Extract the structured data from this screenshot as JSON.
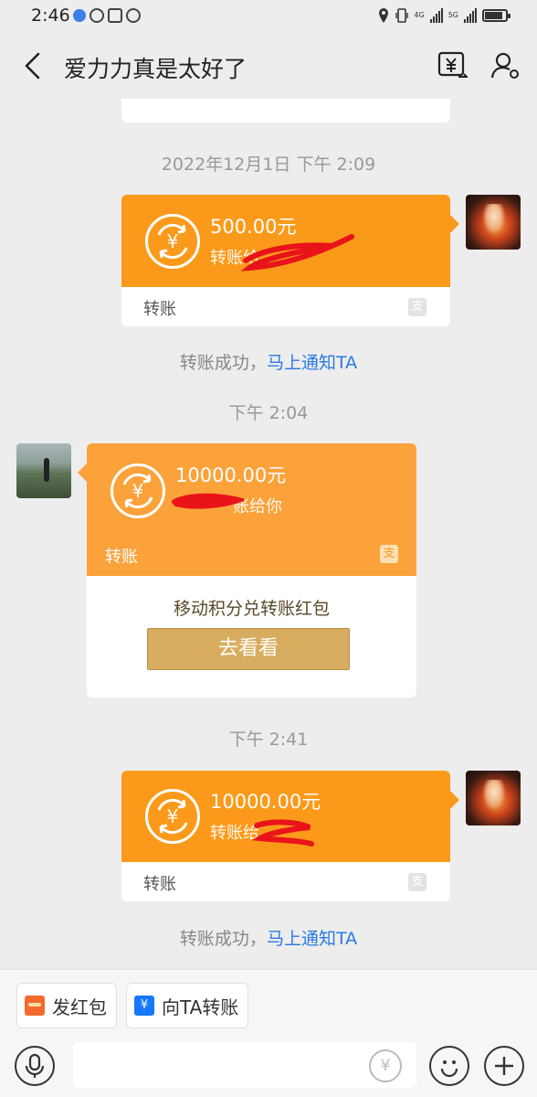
{
  "status_bar": {
    "time": "2:46",
    "network_1": "4G",
    "network_2": "5G",
    "battery_level": 0.85
  },
  "header": {
    "title": "爱力力真是太好了"
  },
  "messages": [
    {
      "timestamp": "2022年12月1日 下午 2:09",
      "direction": "outgoing",
      "amount": "500.00元",
      "subline": "转账给",
      "footer_label": "转账",
      "system_text": "转账成功，",
      "system_link": "马上通知TA"
    },
    {
      "timestamp": "下午 2:04",
      "direction": "incoming",
      "amount": "10000.00元",
      "subline": "账给你",
      "footer_label": "转账",
      "promo_text": "移动积分兑转账红包",
      "promo_button": "去看看"
    },
    {
      "timestamp": "下午 2:41",
      "direction": "outgoing",
      "amount": "10000.00元",
      "subline": "转账给",
      "footer_label": "转账",
      "system_text": "转账成功，",
      "system_link": "马上通知TA"
    }
  ],
  "quick_actions": {
    "red_packet": "发红包",
    "transfer": "向TA转账"
  },
  "input": {
    "placeholder": "",
    "yuan_symbol": "¥"
  },
  "icons": {
    "currency_symbol": "¥",
    "alipay_glyph": "支"
  },
  "colors": {
    "card_orange": "#fb9a1a",
    "link_blue": "#2a7ae2",
    "button_gold": "#d9ad5f"
  }
}
